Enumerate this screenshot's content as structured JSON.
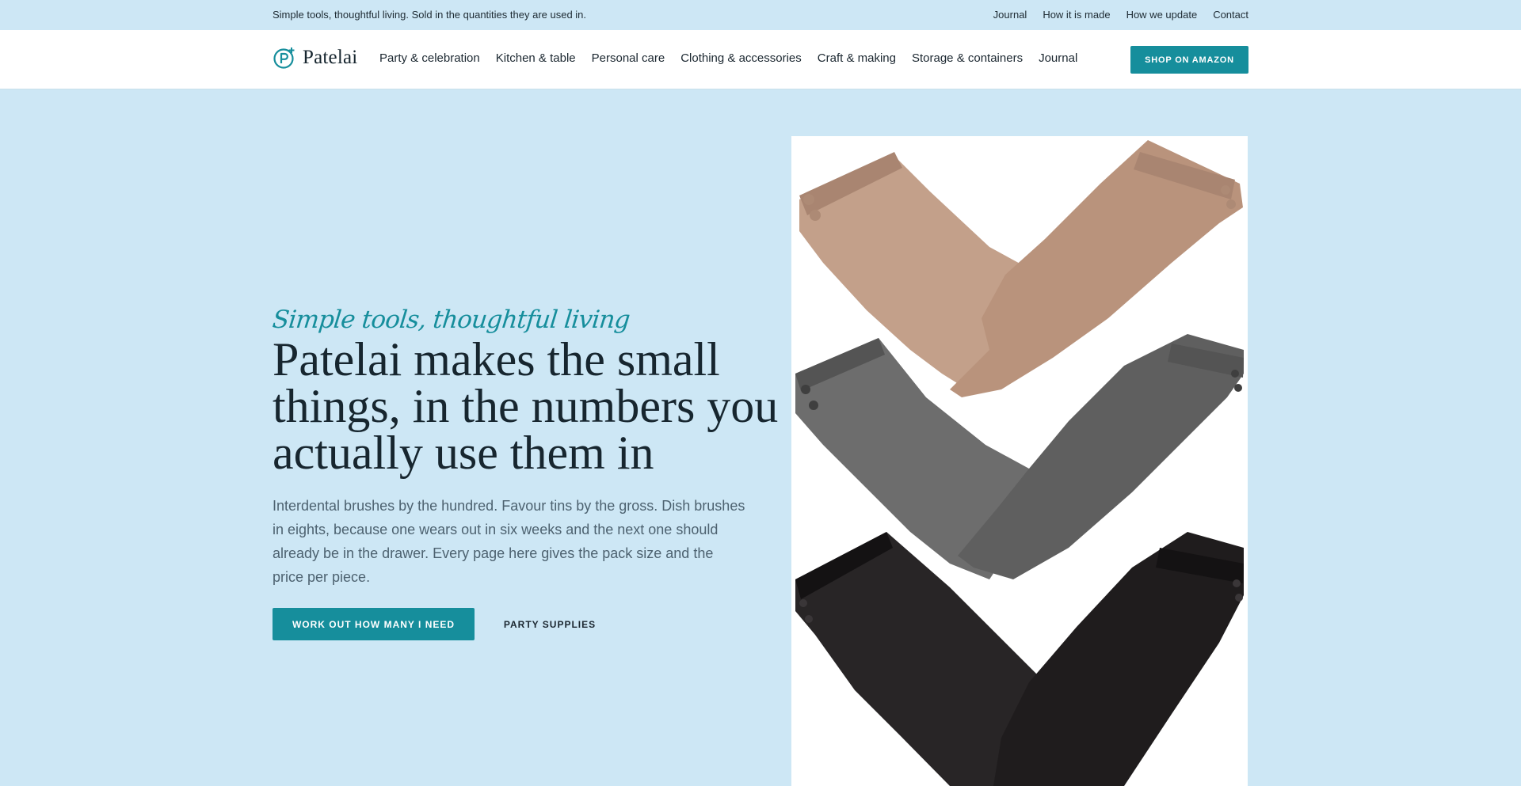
{
  "topbar": {
    "tagline": "Simple tools, thoughtful living. Sold in the quantities they are used in.",
    "links": [
      "Journal",
      "How it is made",
      "How we update",
      "Contact"
    ]
  },
  "header": {
    "brand": "Patelai",
    "nav": [
      "Party & celebration",
      "Kitchen & table",
      "Personal care",
      "Clothing & accessories",
      "Craft & making",
      "Storage & containers",
      "Journal"
    ],
    "shop_button": "SHOP ON AMAZON"
  },
  "hero": {
    "eyebrow": "Simple tools, thoughtful living",
    "headline": "Patelai makes the small things, in the numbers you actually use them in",
    "lead": "Interdental brushes by the hundred. Favour tins by the gross. Dish brushes in eights, because one wears out in six weeks and the next one should already be in the drawer. Every page here gives the pack size and the price per piece.",
    "primary_cta": "WORK OUT HOW MANY I NEED",
    "secondary_cta": "PARTY SUPPLIES"
  },
  "colors": {
    "background": "#cde7f5",
    "accent": "#168e9c",
    "text": "#17262f",
    "glove_beige": "#c3a08a",
    "glove_grey": "#6b6b6b",
    "glove_black": "#262324"
  }
}
